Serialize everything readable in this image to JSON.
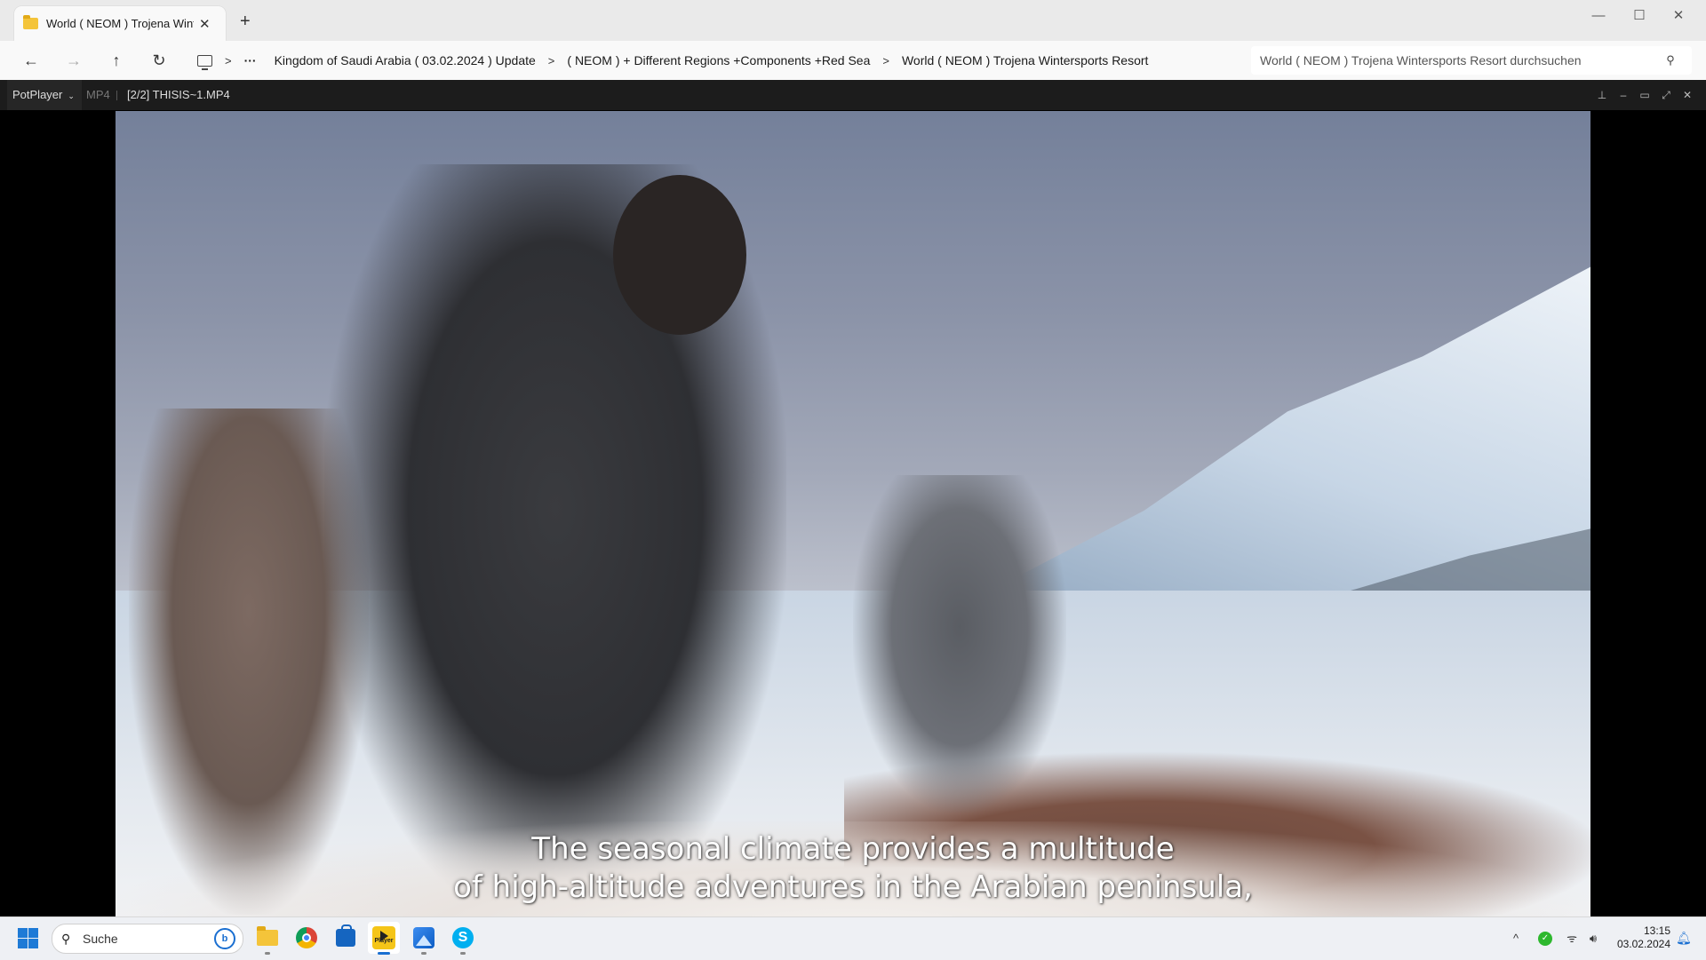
{
  "explorer": {
    "tab_title": "World ( NEOM ) Trojena Winte",
    "tab_close": "✕",
    "new_tab": "+",
    "window_controls": {
      "minimize": "—",
      "maximize": "☐",
      "close": "✕"
    },
    "nav": {
      "back": "←",
      "forward": "→",
      "up": "↑",
      "refresh": "↻"
    },
    "breadcrumb_separator": ">",
    "breadcrumb_more": "···",
    "breadcrumbs": [
      "Kingdom of Saudi Arabia ( 03.02.2024 ) Update",
      "( NEOM ) + Different Regions +Components +Red Sea",
      "World ( NEOM ) Trojena Wintersports Resort"
    ],
    "search_placeholder": "World ( NEOM ) Trojena Wintersports Resort durchsuchen",
    "search_icon": "⚲"
  },
  "player": {
    "brand": "PotPlayer",
    "brand_caret": "⌄",
    "format": "MP4",
    "file": "[2/2] THISIS~1.MP4",
    "controls": {
      "pin": "⊥",
      "minimize": "–",
      "maximize": "▭",
      "fullscreen": "⤢",
      "close": "✕"
    },
    "subtitle_lines": [
      "The seasonal climate provides a multitude",
      "of high-altitude adventures in the Arabian peninsula,"
    ]
  },
  "taskbar": {
    "search_label": "Suche",
    "search_icon": "⚲",
    "bing_badge": "b",
    "apps": [
      {
        "name": "file-explorer"
      },
      {
        "name": "chrome"
      },
      {
        "name": "microsoft-store"
      },
      {
        "name": "potplayer",
        "label": "Player",
        "active": true
      },
      {
        "name": "photos"
      },
      {
        "name": "skype",
        "label": "S"
      }
    ],
    "tray": {
      "chevron": "^",
      "security": "✓",
      "wifi": "ᯤ",
      "volume": "🔊︎"
    },
    "time": "13:15",
    "date": "03.02.2024",
    "notifications": "🔔︎"
  },
  "colors": {
    "accent": "#1a6fd1",
    "player_titlebar": "#1c1c1c",
    "explorer_bg": "#f3f3f3"
  }
}
